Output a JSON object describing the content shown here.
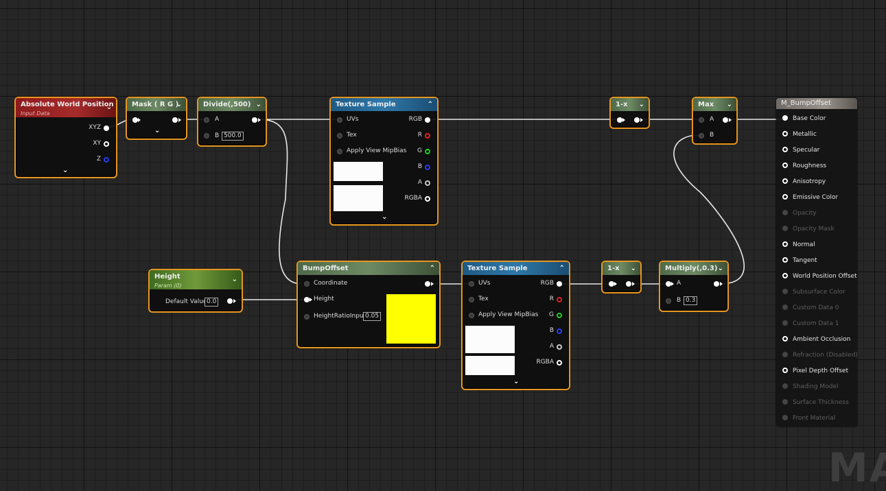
{
  "nodes": {
    "abs_world_pos": {
      "title": "Absolute World Position",
      "subtitle": "Input Data",
      "outputs": [
        "XYZ",
        "XY",
        "Z"
      ]
    },
    "mask": {
      "title": "Mask ( R G )"
    },
    "divide": {
      "title": "Divide(,500)",
      "pin_a": "A",
      "pin_b": "B",
      "b_value": "500.0"
    },
    "tex1": {
      "title": "Texture Sample",
      "inputs": [
        "UVs",
        "Tex",
        "Apply View MipBias"
      ],
      "outputs": [
        "RGB",
        "R",
        "G",
        "B",
        "A",
        "RGBA"
      ]
    },
    "oneminus1": {
      "title": "1-x"
    },
    "max": {
      "title": "Max",
      "pin_a": "A",
      "pin_b": "B"
    },
    "height": {
      "title": "Height",
      "subtitle": "Param (0)",
      "label": "Default Value",
      "value": "0.0"
    },
    "bumpoffset": {
      "title": "BumpOffset",
      "inputs": [
        "Coordinate",
        "Height",
        "HeightRatioInput"
      ],
      "ratio_value": "0.05",
      "preview_color": "#ffff00"
    },
    "tex2": {
      "title": "Texture Sample",
      "inputs": [
        "UVs",
        "Tex",
        "Apply View MipBias"
      ],
      "outputs": [
        "RGB",
        "R",
        "G",
        "B",
        "A",
        "RGBA"
      ]
    },
    "oneminus2": {
      "title": "1-x"
    },
    "multiply": {
      "title": "Multiply(,0.3)",
      "pin_a": "A",
      "pin_b": "B",
      "b_value": "0.3"
    }
  },
  "result": {
    "title": "M_BumpOffset",
    "rows": [
      {
        "label": "Base Color",
        "enabled": true,
        "connected": true
      },
      {
        "label": "Metallic",
        "enabled": true,
        "connected": false
      },
      {
        "label": "Specular",
        "enabled": true,
        "connected": false
      },
      {
        "label": "Roughness",
        "enabled": true,
        "connected": false
      },
      {
        "label": "Anisotropy",
        "enabled": true,
        "connected": false
      },
      {
        "label": "Emissive Color",
        "enabled": true,
        "connected": false
      },
      {
        "label": "Opacity",
        "enabled": false,
        "connected": false
      },
      {
        "label": "Opacity Mask",
        "enabled": false,
        "connected": false
      },
      {
        "label": "Normal",
        "enabled": true,
        "connected": false
      },
      {
        "label": "Tangent",
        "enabled": true,
        "connected": false
      },
      {
        "label": "World Position Offset",
        "enabled": true,
        "connected": false
      },
      {
        "label": "Subsurface Color",
        "enabled": false,
        "connected": false
      },
      {
        "label": "Custom Data 0",
        "enabled": false,
        "connected": false
      },
      {
        "label": "Custom Data 1",
        "enabled": false,
        "connected": false
      },
      {
        "label": "Ambient Occlusion",
        "enabled": true,
        "connected": false
      },
      {
        "label": "Refraction (Disabled)",
        "enabled": false,
        "connected": false
      },
      {
        "label": "Pixel Depth Offset",
        "enabled": true,
        "connected": false
      },
      {
        "label": "Shading Model",
        "enabled": false,
        "connected": false
      },
      {
        "label": "Surface Thickness",
        "enabled": false,
        "connected": false
      },
      {
        "label": "Front Material",
        "enabled": false,
        "connected": false
      }
    ]
  },
  "watermark": "MAT",
  "colors": {
    "selection_border": "#e8971f",
    "wire": "#ffffff",
    "grid_bg": "#262626"
  }
}
